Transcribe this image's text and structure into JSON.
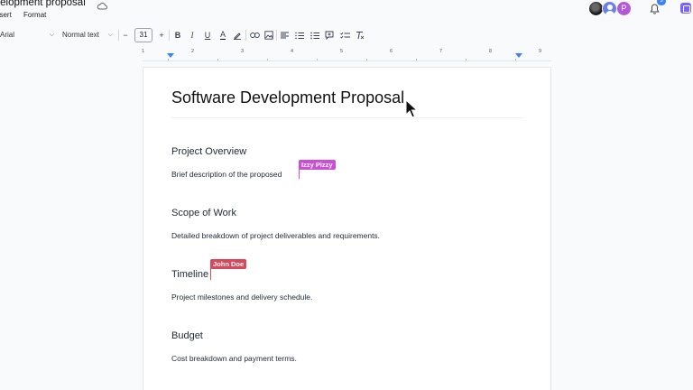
{
  "header": {
    "doc_title": "evelopment proposal",
    "menu": [
      "nsert",
      "Format"
    ],
    "avatar_letter": "P",
    "notification_count": "3"
  },
  "toolbar": {
    "font": "Arial",
    "style": "Normal text",
    "font_size": "31",
    "icons": [
      "minus-icon",
      "plus-icon",
      "bold-icon",
      "italic-icon",
      "underline-icon",
      "text-color-icon",
      "highlight-icon",
      "link-icon",
      "image-icon",
      "align-left-icon",
      "numbered-list-icon",
      "bulleted-list-icon",
      "comment-icon",
      "checklist-icon",
      "clear-format-icon"
    ]
  },
  "ruler": {
    "numbers": [
      "1",
      "2",
      "3",
      "4",
      "5",
      "6",
      "7",
      "8",
      "9"
    ]
  },
  "document": {
    "title": "Software Development Proposal",
    "sections": [
      {
        "heading": "Project Overview",
        "body": "Brief description of the proposed"
      },
      {
        "heading": "Scope of Work",
        "body": "Detailed breakdown of project deliverables and requirements."
      },
      {
        "heading": "Timeline",
        "body": "Project milestones and delivery schedule."
      },
      {
        "heading": "Budget",
        "body": "Cost breakdown and payment terms."
      }
    ]
  },
  "collaborators": [
    {
      "name": "Izzy Pizzy",
      "color": "#c94fd8"
    },
    {
      "name": "John Doe",
      "color": "#d9475a"
    }
  ]
}
